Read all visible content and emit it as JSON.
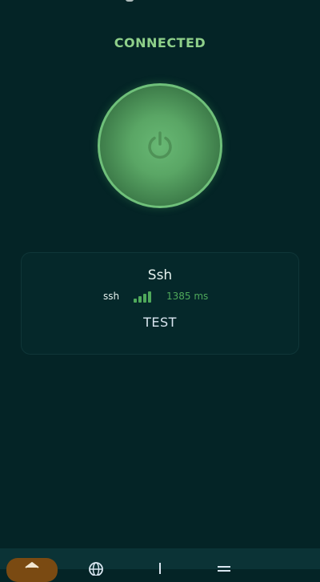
{
  "status": {
    "label": "CONNECTED",
    "color": "#8fd08a"
  },
  "power_button": {
    "icon": "power-icon",
    "accent": "#6fc07a"
  },
  "server": {
    "name": "Ssh",
    "protocol": "ssh",
    "ping": "1385 ms",
    "ping_color": "#4fa95b",
    "signal_bars": 4,
    "signal_color": "#4fa95b",
    "test_label": "TEST"
  },
  "bottom_nav": {
    "items": [
      {
        "icon": "home-icon",
        "active": true
      },
      {
        "icon": "globe-icon",
        "active": false
      },
      {
        "icon": "plus-icon",
        "active": false
      },
      {
        "icon": "menu-icon",
        "active": false
      }
    ],
    "active_color": "#7a4a12"
  }
}
